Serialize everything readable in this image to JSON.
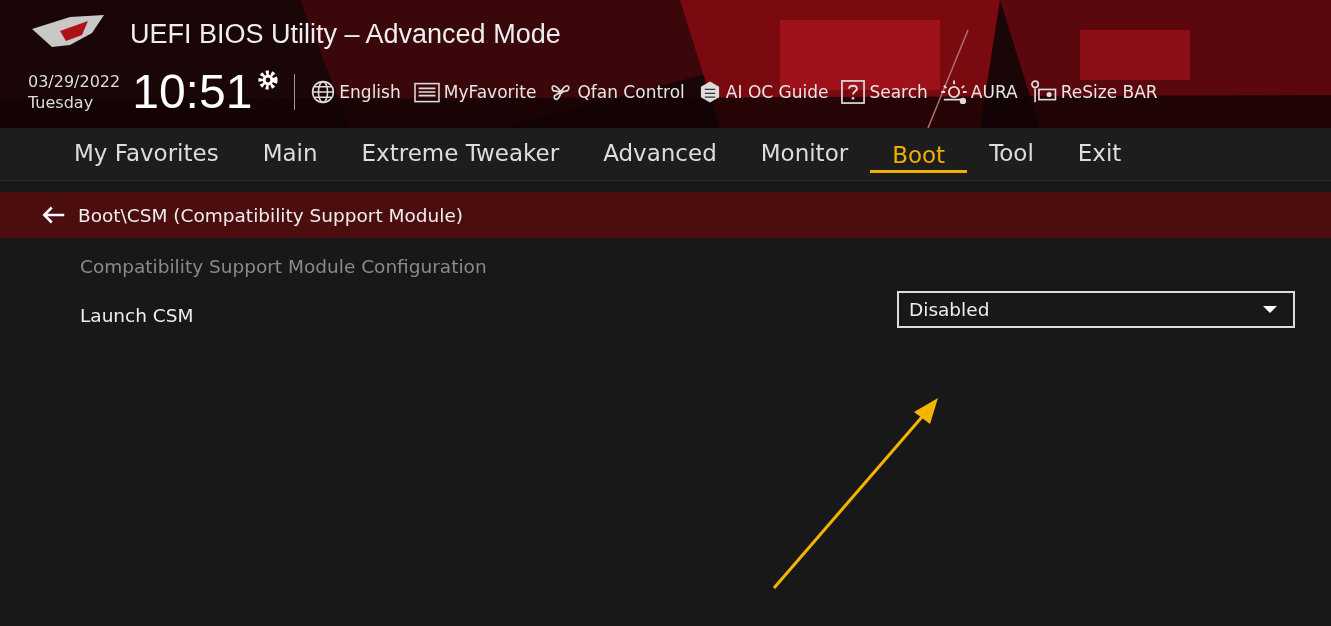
{
  "window": {
    "title": "UEFI BIOS Utility – Advanced Mode"
  },
  "clock": {
    "date": "03/29/2022",
    "weekday": "Tuesday",
    "time": "10:51"
  },
  "toolbar": [
    {
      "label": "English"
    },
    {
      "label": "MyFavorite"
    },
    {
      "label": "Qfan Control"
    },
    {
      "label": "AI OC Guide"
    },
    {
      "label": "Search"
    },
    {
      "label": "AURA"
    },
    {
      "label": "ReSize BAR"
    }
  ],
  "tabs": [
    {
      "label": "My Favorites",
      "selected": false
    },
    {
      "label": "Main",
      "selected": false
    },
    {
      "label": "Extreme Tweaker",
      "selected": false
    },
    {
      "label": "Advanced",
      "selected": false
    },
    {
      "label": "Monitor",
      "selected": false
    },
    {
      "label": "Boot",
      "selected": true
    },
    {
      "label": "Tool",
      "selected": false
    },
    {
      "label": "Exit",
      "selected": false
    }
  ],
  "breadcrumb": "Boot\\CSM (Compatibility Support Module)",
  "section_title": "Compatibility Support Module Configuration",
  "settings": [
    {
      "label": "Launch CSM",
      "value": "Disabled"
    }
  ]
}
